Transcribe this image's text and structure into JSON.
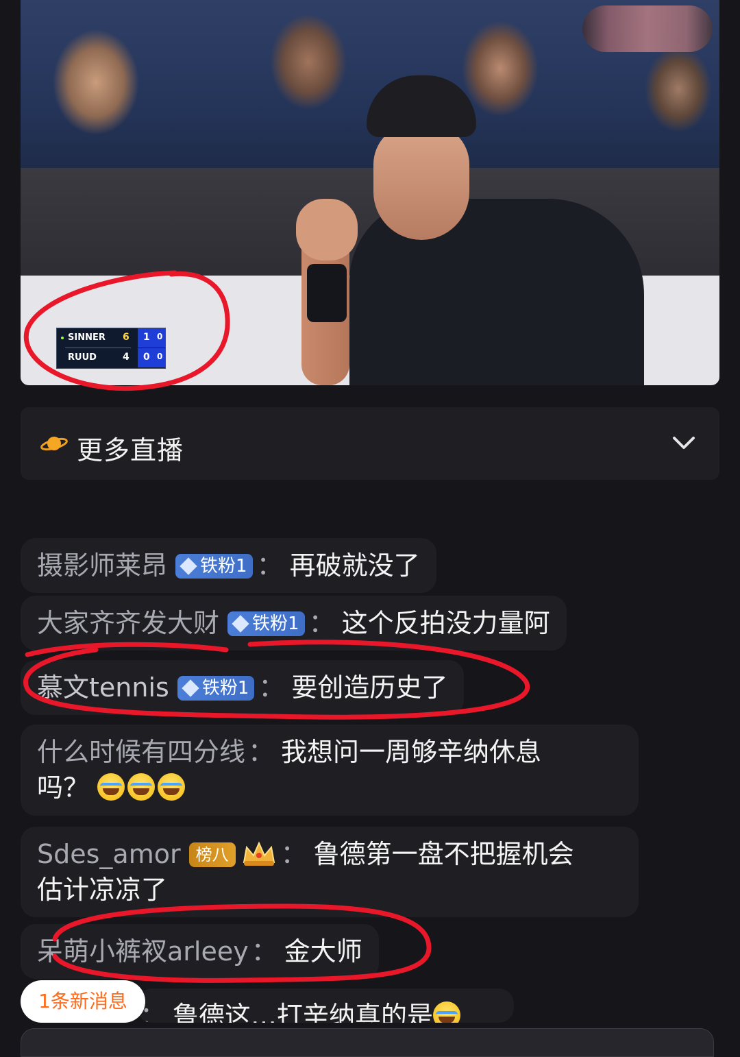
{
  "scoreboard": {
    "players": [
      {
        "name": "SINNER",
        "set1": "6",
        "set2": "1",
        "game": "0"
      },
      {
        "name": "RUUD",
        "set1": "4",
        "set2": "0",
        "game": "0"
      }
    ]
  },
  "more_live": {
    "label": "更多直播"
  },
  "chat": [
    {
      "user": "摄影师莱昂",
      "badge": "铁粉1",
      "colon": "：",
      "text": "再破就没了"
    },
    {
      "user": "大家齐齐发大财",
      "badge": "铁粉1",
      "colon": "：",
      "text": "这个反拍没力量阿"
    },
    {
      "user": "慕文tennis",
      "badge": "铁粉1",
      "colon": "：",
      "text": "要创造历史了"
    },
    {
      "user": "什么时候有四分线",
      "colon": "：",
      "text": "我想问一周够辛纳休息",
      "text2": "吗？"
    },
    {
      "user": "Sdes_amor",
      "rank": "榜八",
      "colon": "：",
      "text": "鲁德第一盘不把握机会",
      "text2": "估计凉凉了"
    },
    {
      "user": "呆萌小裤衩arleey",
      "colon": "：",
      "text": "金大师"
    },
    {
      "colon": "：",
      "text": "鲁德这…打辛纳真的是"
    }
  ],
  "new_message_pill": "1条新消息",
  "colors": {
    "annotation": "#e8182a",
    "badge": "#4b7ed8",
    "rank_badge": "#d9951f",
    "new_msg_text": "#ff6a1a"
  }
}
